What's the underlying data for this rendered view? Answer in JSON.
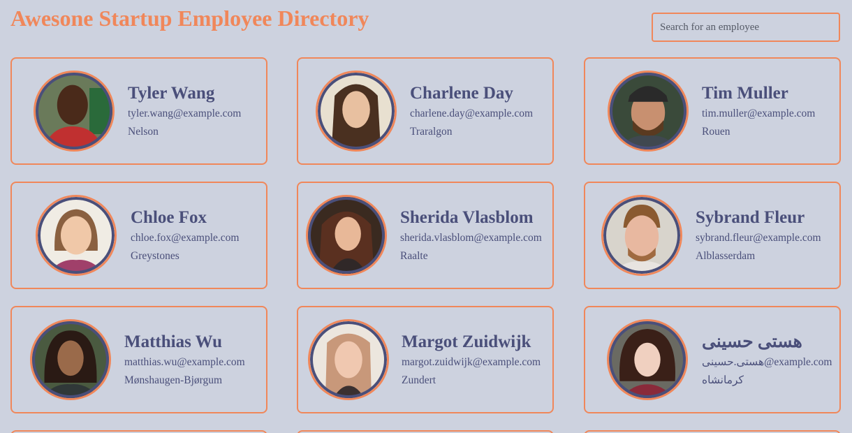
{
  "header": {
    "title": "Awesone Startup Employee Directory",
    "search_placeholder": "Search for an employee",
    "search_value": ""
  },
  "colors": {
    "background": "#cdd2df",
    "accent": "#f0875a",
    "text": "#4a4f7a"
  },
  "employees": [
    {
      "name": "Tyler Wang",
      "email": "tyler.wang@example.com",
      "city": "Nelson",
      "avatar": "employee-photo"
    },
    {
      "name": "Charlene Day",
      "email": "charlene.day@example.com",
      "city": "Traralgon",
      "avatar": "employee-photo"
    },
    {
      "name": "Tim Muller",
      "email": "tim.muller@example.com",
      "city": "Rouen",
      "avatar": "employee-photo"
    },
    {
      "name": "Chloe Fox",
      "email": "chloe.fox@example.com",
      "city": "Greystones",
      "avatar": "employee-photo"
    },
    {
      "name": "Sherida Vlasblom",
      "email": "sherida.vlasblom@example.com",
      "city": "Raalte",
      "avatar": "employee-photo"
    },
    {
      "name": "Sybrand Fleur",
      "email": "sybrand.fleur@example.com",
      "city": "Alblasserdam",
      "avatar": "employee-photo"
    },
    {
      "name": "Matthias Wu",
      "email": "matthias.wu@example.com",
      "city": "Mønshaugen-Bjørgum",
      "avatar": "employee-photo"
    },
    {
      "name": "Margot Zuidwijk",
      "email": "margot.zuidwijk@example.com",
      "city": "Zundert",
      "avatar": "employee-photo"
    },
    {
      "name": "هستی حسینی",
      "email": "هستی.حسینی@example.com",
      "city": "کرمانشاه",
      "avatar": "employee-photo"
    }
  ]
}
